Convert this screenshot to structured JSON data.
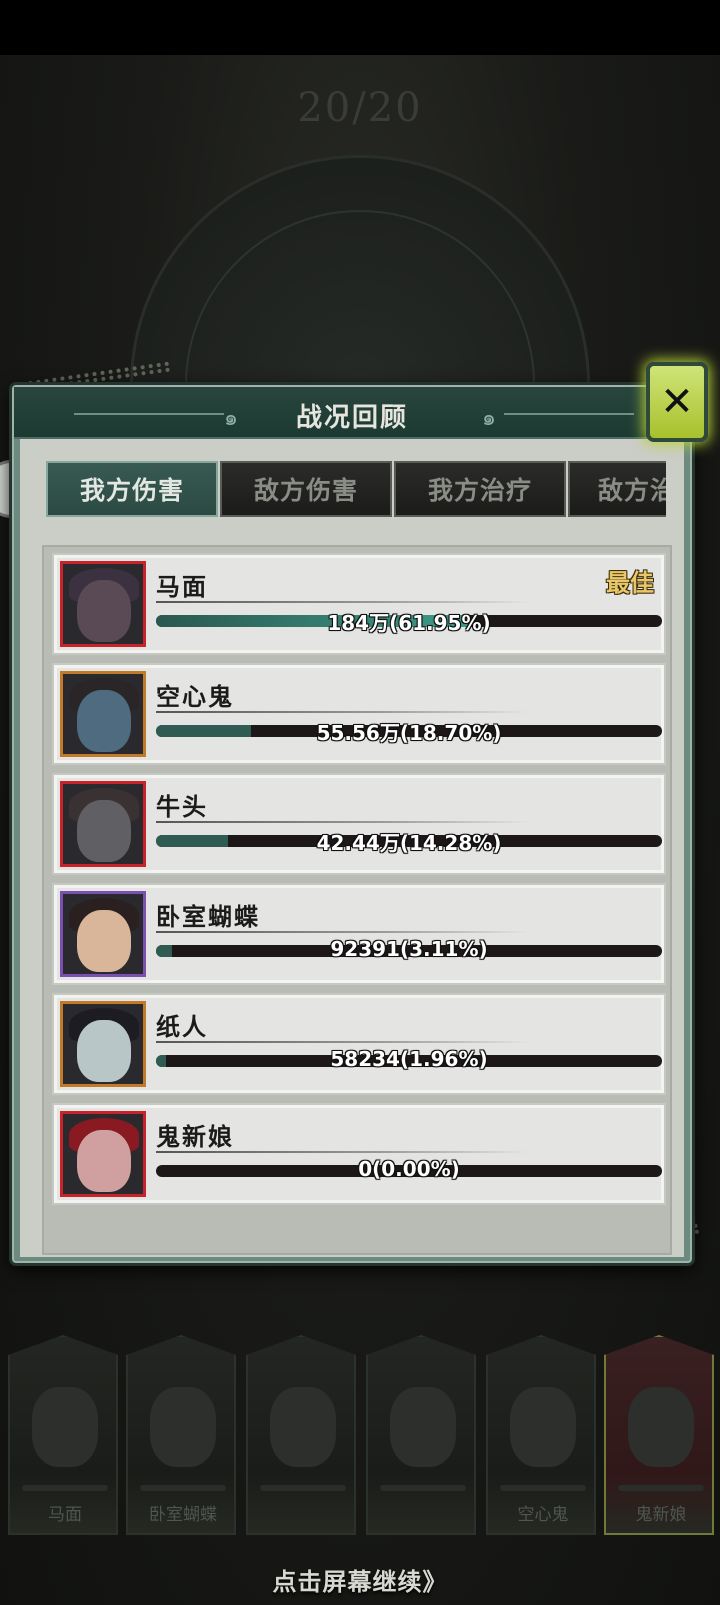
{
  "background": {
    "round_counter": "20/20"
  },
  "panel": {
    "title": "战况回顾",
    "close_label": "✕"
  },
  "tabs": [
    {
      "label": "我方伤害",
      "active": true
    },
    {
      "label": "敌方伤害",
      "active": false
    },
    {
      "label": "我方治疗",
      "active": false
    },
    {
      "label": "敌方治",
      "active": false
    }
  ],
  "best_label": "最佳",
  "rows": [
    {
      "name": "马面",
      "value_text": "184万(61.95%)",
      "percent": 61.95,
      "frame_color": "#c8222a",
      "is_best": true
    },
    {
      "name": "空心鬼",
      "value_text": "55.56万(18.70%)",
      "percent": 18.7,
      "frame_color": "#c07a2a",
      "is_best": false
    },
    {
      "name": "牛头",
      "value_text": "42.44万(14.28%)",
      "percent": 14.28,
      "frame_color": "#c8222a",
      "is_best": false
    },
    {
      "name": "卧室蝴蝶",
      "value_text": "92391(3.11%)",
      "percent": 3.11,
      "frame_color": "#7a4fb0",
      "is_best": false
    },
    {
      "name": "纸人",
      "value_text": "58234(1.96%)",
      "percent": 1.96,
      "frame_color": "#c07a2a",
      "is_best": false
    },
    {
      "name": "鬼新娘",
      "value_text": "0(0.00%)",
      "percent": 0.0,
      "frame_color": "#c8222a",
      "is_best": false
    }
  ],
  "roster": [
    {
      "name": "马面",
      "active": false
    },
    {
      "name": "卧室蝴蝶",
      "active": false
    },
    {
      "name": "",
      "active": false
    },
    {
      "name": "",
      "active": false
    },
    {
      "name": "空心鬼",
      "active": false
    },
    {
      "name": "鬼新娘",
      "active": true
    }
  ],
  "continue_hint": "点击屏幕继续》",
  "colors": {
    "panel_header": "#1c3a32",
    "tab_active": "#2b4a43",
    "bar_fill": "#2f5b53",
    "best_gold": "#e8c76a",
    "close_button": "#b7d23a"
  }
}
